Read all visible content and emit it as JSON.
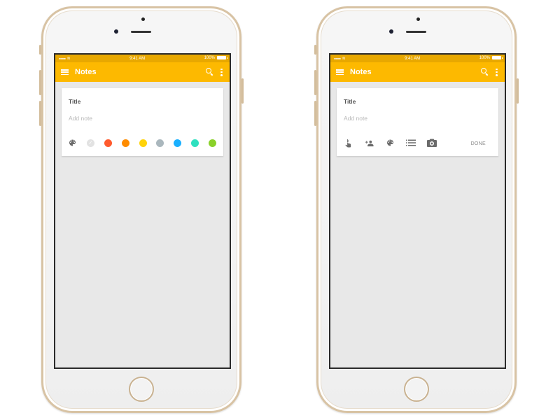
{
  "colors": {
    "status_bar": "#e8a800",
    "toolbar": "#fdb900",
    "screen_bg": "#e8e8e8",
    "card_bg": "#ffffff",
    "icon_gray": "#6b6b6b"
  },
  "phones": [
    {
      "status_bar": {
        "signal": "●●●●●",
        "wifi_icon": "wifi-icon",
        "time": "9:41 AM",
        "battery": "100%"
      },
      "toolbar": {
        "menu_icon": "menu-icon",
        "title": "Notes",
        "search_icon": "search-icon",
        "more_icon": "more-vert-icon"
      },
      "card": {
        "title": "Title",
        "note_placeholder": "Add note",
        "palette_icon": "palette-icon",
        "swatches": [
          {
            "name": "white",
            "color": "#e2e2e2",
            "selected": true
          },
          {
            "name": "red",
            "color": "#ff5a2d"
          },
          {
            "name": "orange",
            "color": "#ff8c00"
          },
          {
            "name": "yellow",
            "color": "#ffd30a"
          },
          {
            "name": "gray",
            "color": "#aab7bd"
          },
          {
            "name": "blue",
            "color": "#1ab0ff"
          },
          {
            "name": "teal",
            "color": "#2ee0bf"
          },
          {
            "name": "green",
            "color": "#8ad12a"
          }
        ]
      }
    },
    {
      "status_bar": {
        "signal": "●●●●●",
        "wifi_icon": "wifi-icon",
        "time": "9:41 AM",
        "battery": "100%"
      },
      "toolbar": {
        "menu_icon": "menu-icon",
        "title": "Notes",
        "search_icon": "search-icon",
        "more_icon": "more-vert-icon"
      },
      "card": {
        "title": "Title",
        "note_placeholder": "Add note",
        "actions": [
          "reminder-icon",
          "add-collaborator-icon",
          "palette-icon",
          "list-icon",
          "camera-icon"
        ],
        "done_label": "DONE"
      }
    }
  ]
}
